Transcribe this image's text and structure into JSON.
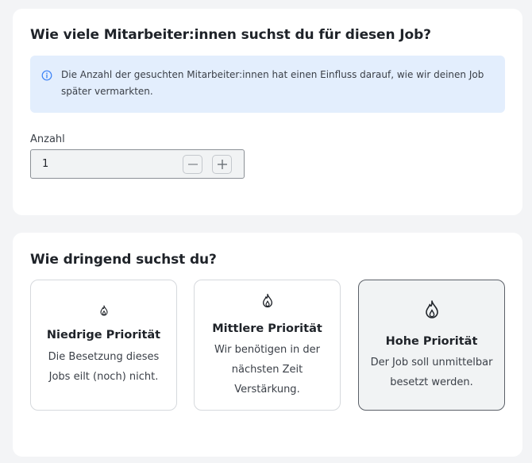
{
  "employees_section": {
    "title": "Wie viele Mitarbeiter:innen suchst du für diesen Job?",
    "info_icon": "info-circle-icon",
    "info_text": "Die Anzahl der gesuchten Mitarbeiter:innen hat einen Einfluss darauf, wie wir deinen Job später vermarkten.",
    "quantity": {
      "label": "Anzahl",
      "value": "1",
      "decrement_icon": "minus-icon",
      "increment_icon": "plus-icon"
    }
  },
  "urgency_section": {
    "title": "Wie dringend suchst du?",
    "options": [
      {
        "icon": "flame-icon-small",
        "title": "Niedrige Priorität",
        "description": "Die Besetzung dieses Jobs eilt (noch) nicht.",
        "selected": false
      },
      {
        "icon": "flame-icon-medium",
        "title": "Mittlere Priorität",
        "description": "Wir benötigen in der nächsten Zeit Verstärkung.",
        "selected": false
      },
      {
        "icon": "flame-icon-large",
        "title": "Hohe Priorität",
        "description": "Der Job soll unmittelbar besetzt werden.",
        "selected": true
      }
    ]
  },
  "colors": {
    "info_background": "#e3eefd",
    "info_icon": "#3b82f6",
    "selected_background": "#f1f3f4",
    "selected_border": "#5b6068"
  }
}
